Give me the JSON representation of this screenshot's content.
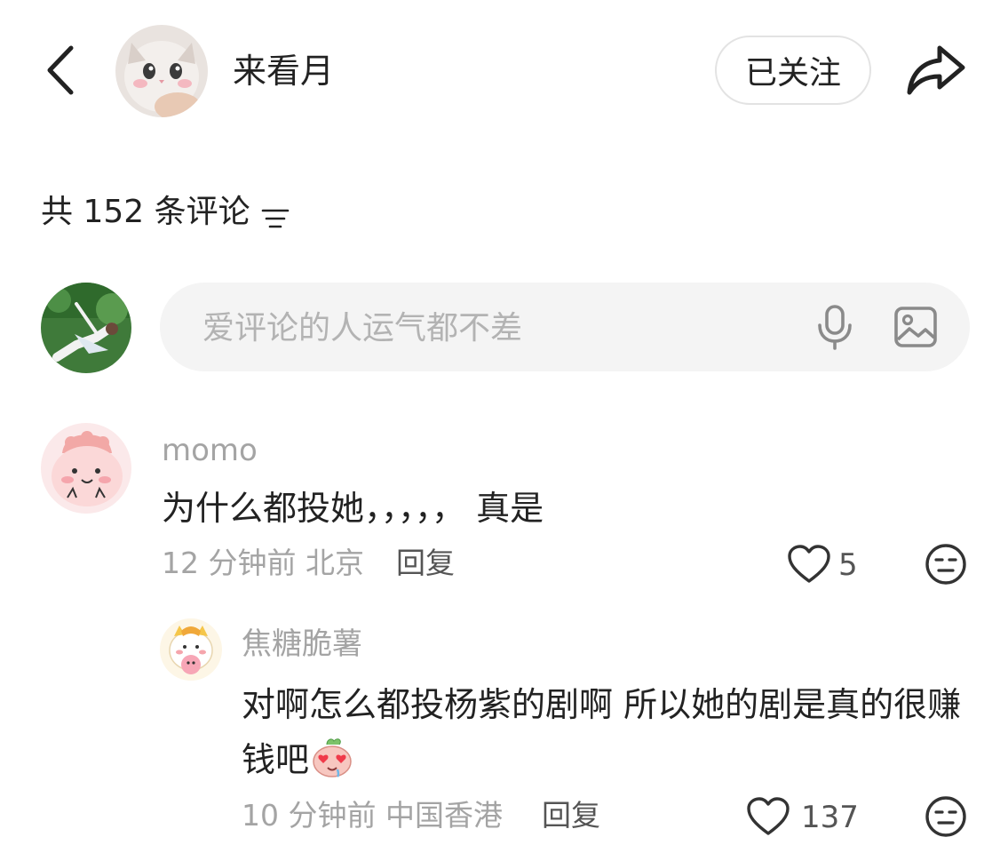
{
  "header": {
    "back_icon": "chevron-left-icon",
    "author_name": "来看月",
    "author_avatar": "cat-avatar",
    "follow_label": "已关注",
    "share_icon": "share-arrow-icon"
  },
  "comments_header": {
    "count_text": "共 152 条评论",
    "sort_icon": "sort-lines-icon"
  },
  "comment_input": {
    "placeholder": "爱评论的人运气都不差",
    "mic_icon": "microphone-icon",
    "image_icon": "image-icon",
    "user_avatar": "grass-girl-avatar"
  },
  "comments": [
    {
      "username": "momo",
      "text": "为什么都投她，，，，， 真是",
      "time_location": "12 分钟前 北京",
      "reply_label": "回复",
      "likes": "5",
      "avatar": "pink-blob-avatar"
    },
    {
      "username": "焦糖脆薯",
      "text": "对啊怎么都投杨紫的剧啊 所以她的剧是真的很赚钱吧",
      "time_location": "10 分钟前 中国香港",
      "reply_label": "回复",
      "likes": "137",
      "avatar": "cartoon-cat-avatar",
      "emoji": "heart-eyes-emoji"
    }
  ],
  "colors": {
    "text_primary": "#222222",
    "text_secondary": "#a4a4a4",
    "input_bg": "#f4f4f4",
    "follow_border": "#e3e3e3"
  }
}
